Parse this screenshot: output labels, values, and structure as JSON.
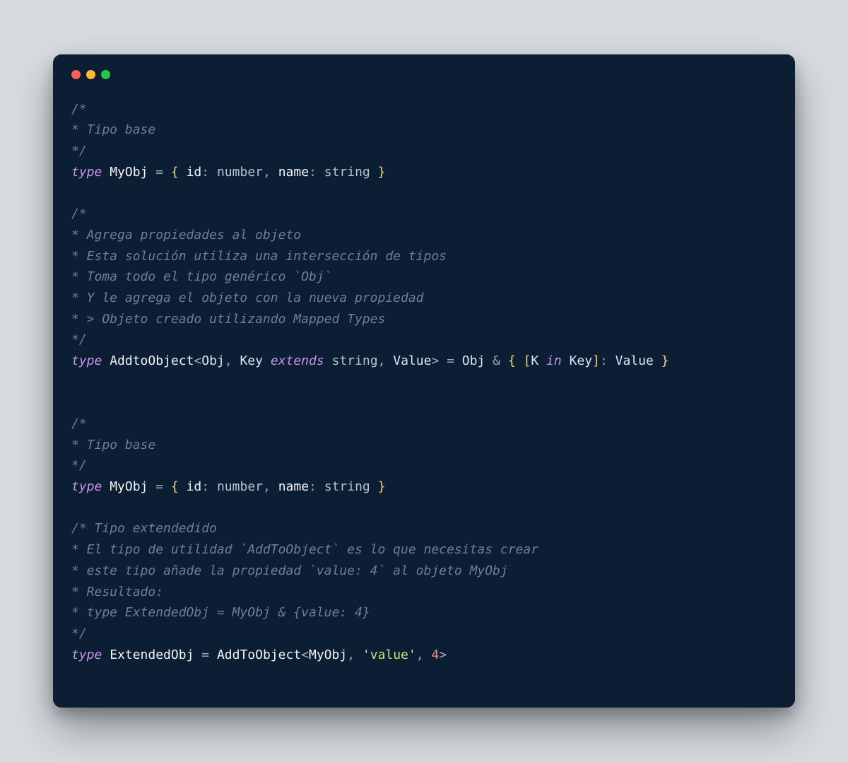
{
  "colors": {
    "bg_page": "#d6dce0",
    "bg_window": "#0c1e34",
    "dot_red": "#ff5f56",
    "dot_yellow": "#ffbd2e",
    "dot_green": "#27c93f",
    "comment": "#6f7e94",
    "keyword": "#c792ea",
    "identifier": "#f3f4f6",
    "type": "#b7c2cf",
    "brace": "#f8d477",
    "string": "#c3e88d",
    "number": "#f78c6c"
  },
  "code": {
    "c1_l1": "/*",
    "c1_l2": "* Tipo base",
    "c1_l3": "*/",
    "kw_type": "type",
    "myobj_name": "MyObj",
    "eq": " = ",
    "brace_open": "{ ",
    "id_key": "id",
    "colon_sp": ": ",
    "ty_number": "number",
    "comma_sp": ", ",
    "name_key": "name",
    "ty_string": "string",
    "brace_close": " }",
    "c2_l1": "/*",
    "c2_l2": "* Agrega propiedades al objeto",
    "c2_l3": "* Esta solución utiliza una intersección de tipos",
    "c2_l4": "* Toma todo el tipo genérico `Obj`",
    "c2_l5": "* Y le agrega el objeto con la nueva propiedad",
    "c2_l6": "* > Objeto creado utilizando Mapped Types",
    "c2_l7": "*/",
    "addto_name": "AddtoObject",
    "lt": "<",
    "tp_obj": "Obj",
    "tp_key": "Key",
    "kw_extends": "extends",
    "tp_value": "Value",
    "gt": ">",
    "amp": " & ",
    "lbracket": "[",
    "tp_k": "K",
    "kw_in": "in",
    "rbracket": "]",
    "c3_l1": "/*",
    "c3_l2": "* Tipo base",
    "c3_l3": "*/",
    "c4_l1": "/* Tipo extendedido",
    "c4_l2": "* El tipo de utilidad `AddToObject` es lo que necesitas crear",
    "c4_l3": "* este tipo añade la propiedad `value: 4` al objeto MyObj",
    "c4_l4": "* Resultado:",
    "c4_l5": "* type ExtendedObj = MyObj & {value: 4}",
    "c4_l6": "*/",
    "ext_name": "ExtendedObj",
    "addto_name2": "AddToObject",
    "myobj_ref": "MyObj",
    "str_value": "'value'",
    "num_4": "4"
  }
}
